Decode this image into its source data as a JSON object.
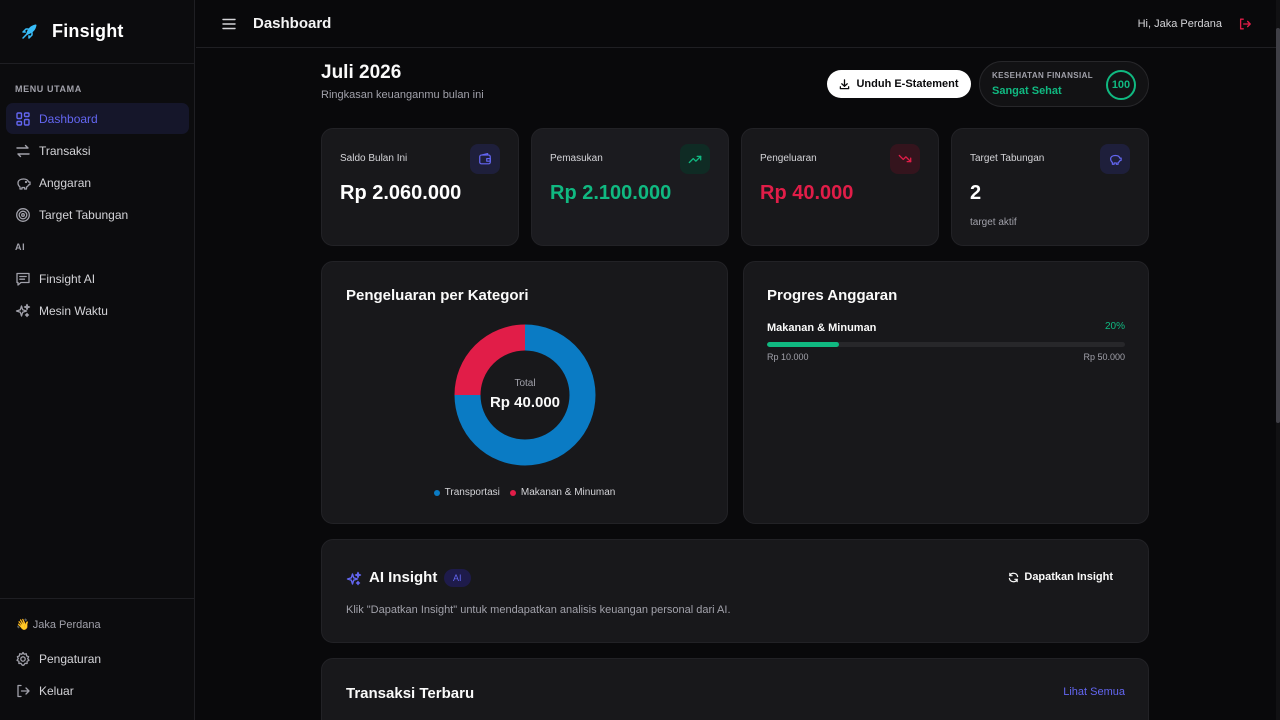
{
  "app": {
    "name": "Finsight"
  },
  "sidebar": {
    "sections": [
      {
        "label": "MENU UTAMA",
        "items": [
          {
            "label": "Dashboard",
            "icon": "grid-icon",
            "active": true
          },
          {
            "label": "Transaksi",
            "icon": "arrows-exchange-icon"
          },
          {
            "label": "Anggaran",
            "icon": "piggy-bank-icon"
          },
          {
            "label": "Target Tabungan",
            "icon": "target-icon"
          }
        ]
      },
      {
        "label": "AI",
        "items": [
          {
            "label": "Finsight AI",
            "icon": "chat-icon"
          },
          {
            "label": "Mesin Waktu",
            "icon": "sparkles-icon"
          }
        ]
      }
    ],
    "footer": {
      "user": "👋 Jaka Perdana",
      "settings": "Pengaturan",
      "logout": "Keluar"
    }
  },
  "topbar": {
    "title": "Dashboard",
    "greeting": "Hi, Jaka Perdana"
  },
  "header": {
    "period": "Juli 2026",
    "subtitle": "Ringkasan keuanganmu bulan ini",
    "statement_button": "Unduh E-Statement",
    "health": {
      "label": "KESEHATAN FINANSIAL",
      "status": "Sangat Sehat",
      "score": "100"
    }
  },
  "stats": [
    {
      "label": "Saldo Bulan Ini",
      "value": "Rp 2.060.000",
      "icon": "wallet-icon",
      "color": "#ffffff"
    },
    {
      "label": "Pemasukan",
      "value": "Rp 2.100.000",
      "icon": "trending-up-icon",
      "color": "#10b981"
    },
    {
      "label": "Pengeluaran",
      "value": "Rp 40.000",
      "icon": "trending-down-icon",
      "color": "#e11d48"
    },
    {
      "label": "Target Tabungan",
      "value": "2",
      "sub": "target aktif",
      "icon": "piggy-bank-icon",
      "color": "#ffffff"
    }
  ],
  "category_panel": {
    "title": "Pengeluaran per Kategori",
    "center_label": "Total",
    "center_value": "Rp 40.000"
  },
  "chart_data": {
    "type": "pie",
    "categories": [
      "Transportasi",
      "Makanan & Minuman"
    ],
    "values": [
      30000,
      10000
    ],
    "colors": [
      "#0a7bc4",
      "#e11d48"
    ],
    "donut": true,
    "legend_position": "bottom"
  },
  "budget_panel": {
    "title": "Progres Anggaran",
    "items": [
      {
        "name": "Makanan & Minuman",
        "percent_label": "20%",
        "progress": 0.2,
        "spent": "Rp 10.000",
        "limit": "Rp 50.000"
      }
    ]
  },
  "ai_insight": {
    "title": "AI Insight",
    "badge": "AI",
    "description": "Klik \"Dapatkan Insight\" untuk mendapatkan analisis keuangan personal dari AI.",
    "button": "Dapatkan Insight"
  },
  "recent": {
    "title": "Transaksi Terbaru",
    "see_all": "Lihat Semua"
  },
  "colors": {
    "accent": "#6366f1",
    "positive": "#10b981",
    "negative": "#e11d48",
    "background": "#09090b",
    "card": "#18181b"
  }
}
